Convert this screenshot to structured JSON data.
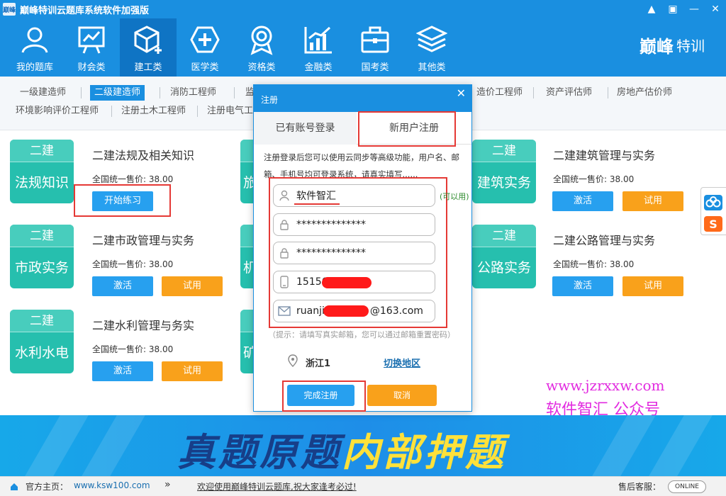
{
  "window": {
    "title": "巅峰特训云题库系统软件加强版",
    "icon_text": "巅峰"
  },
  "window_controls": {
    "user": "▲",
    "menu": "▣",
    "minimize": "—",
    "close": "✕"
  },
  "nav": {
    "items": [
      {
        "label": "我的题库",
        "icon": "user-icon"
      },
      {
        "label": "财会类",
        "icon": "chart-board-icon"
      },
      {
        "label": "建工类",
        "icon": "cube-icon"
      },
      {
        "label": "医学类",
        "icon": "medical-cross-icon"
      },
      {
        "label": "资格类",
        "icon": "medal-icon"
      },
      {
        "label": "金融类",
        "icon": "bar-chart-icon"
      },
      {
        "label": "国考类",
        "icon": "briefcase-icon"
      },
      {
        "label": "其他类",
        "icon": "layers-icon"
      }
    ],
    "brand": "巅峰",
    "brand2": "特训"
  },
  "subnav": {
    "row1": [
      "一级建造师",
      "二级建造师",
      "消防工程师",
      "监",
      "造价工程师",
      "资产评估师",
      "房地产估价师"
    ],
    "row2": [
      "环境影响评价工程师",
      "注册土木工程师",
      "注册电气工"
    ]
  },
  "cards": [
    {
      "tile_top": "二建",
      "tile_main": "法规知识",
      "title": "二建法规及相关知识",
      "price": "全国统一售价: 38.00",
      "primary": "开始练习",
      "secondary": ""
    },
    {
      "tile_top": "二建",
      "tile_main": "市政实务",
      "title": "二建市政管理与实务",
      "price": "全国统一售价: 38.00",
      "primary": "激活",
      "secondary": "试用"
    },
    {
      "tile_top": "二建",
      "tile_main": "水利水电",
      "title": "二建水利管理与务实",
      "price": "全国统一售价: 38.00",
      "primary": "激活",
      "secondary": "试用"
    },
    {
      "tile_top": "二建",
      "tile_main": "建筑实务",
      "title": "二建建筑管理与实务",
      "price": "全国统一售价: 38.00",
      "primary": "激活",
      "secondary": "试用"
    },
    {
      "tile_top": "二建",
      "tile_main": "公路实务",
      "title": "二建公路管理与实务",
      "price": "全国统一售价: 38.00",
      "primary": "激活",
      "secondary": "试用"
    }
  ],
  "hidden_tiles": [
    "旅",
    "机",
    "矿"
  ],
  "modal": {
    "title": "注册",
    "close": "✕",
    "tab_login": "已有账号登录",
    "tab_register": "新用户注册",
    "tip": "注册登录后您可以使用云同步等高级功能，用户名、邮箱、手机号均可登录系统，请真实填写......",
    "username": "软件智汇",
    "available": "(可以用)",
    "password": "**************",
    "confirm_password": "**************",
    "phone": "15156",
    "email_prefix": "ruanji",
    "email_suffix": "@163.com",
    "hint": "（提示：请填写真实邮箱，您可以通过邮箱重置密码）",
    "region": "浙江1",
    "switch_region": "切换地区",
    "submit": "完成注册",
    "cancel": "取消"
  },
  "banner": {
    "text1": "真题原题",
    "text2": "内部押题"
  },
  "watermark": {
    "url": "www.jzrxxw.com",
    "name": "软件智汇 公众号"
  },
  "status": {
    "homepage_label": "官方主页：",
    "homepage_url": "www.ksw100.com",
    "arrows": "»",
    "welcome": "欢迎使用巅峰特训云题库,祝大家逢考必过!",
    "support_label": "售后客服：",
    "online": "ONLINE"
  },
  "colors": {
    "primary": "#1a8fe0",
    "tile": "#26bfae",
    "orange": "#f9a11b",
    "highlight_red": "#e53935",
    "watermark": "#e22be0"
  }
}
